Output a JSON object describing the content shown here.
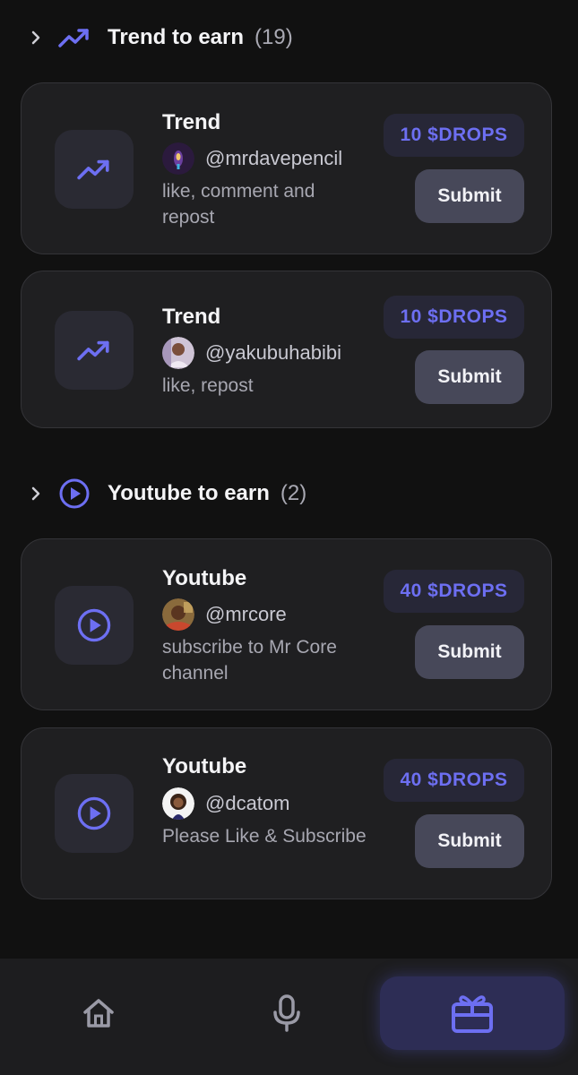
{
  "colors": {
    "background": "#111111",
    "card": "#1f1f21",
    "accent": "#6d6ff2",
    "reward_bg": "#272737",
    "submit_bg": "#474859"
  },
  "sections": [
    {
      "title": "Trend to earn",
      "count": "(19)",
      "icon": "trending-up-icon",
      "cards": [
        {
          "title": "Trend",
          "username": "@mrdavepencil",
          "description": "like, comment and repost",
          "reward": "10 $DROPS",
          "submit_label": "Submit",
          "icon": "trending-up-icon"
        },
        {
          "title": "Trend",
          "username": "@yakubuhabibi",
          "description": "like, repost",
          "reward": "10 $DROPS",
          "submit_label": "Submit",
          "icon": "trending-up-icon"
        }
      ]
    },
    {
      "title": "Youtube to earn",
      "count": "(2)",
      "icon": "play-circle-icon",
      "cards": [
        {
          "title": "Youtube",
          "username": "@mrcore",
          "description": "subscribe to Mr Core channel",
          "reward": "40 $DROPS",
          "submit_label": "Submit",
          "icon": "play-circle-icon"
        },
        {
          "title": "Youtube",
          "username": "@dcatom",
          "description": "Please Like & Subscribe",
          "reward": "40 $DROPS",
          "submit_label": "Submit",
          "icon": "play-circle-icon"
        }
      ]
    }
  ],
  "bottom_nav": {
    "items": [
      {
        "icon": "home-icon",
        "active": false
      },
      {
        "icon": "microphone-icon",
        "active": false
      },
      {
        "icon": "gift-icon",
        "active": true
      }
    ]
  }
}
